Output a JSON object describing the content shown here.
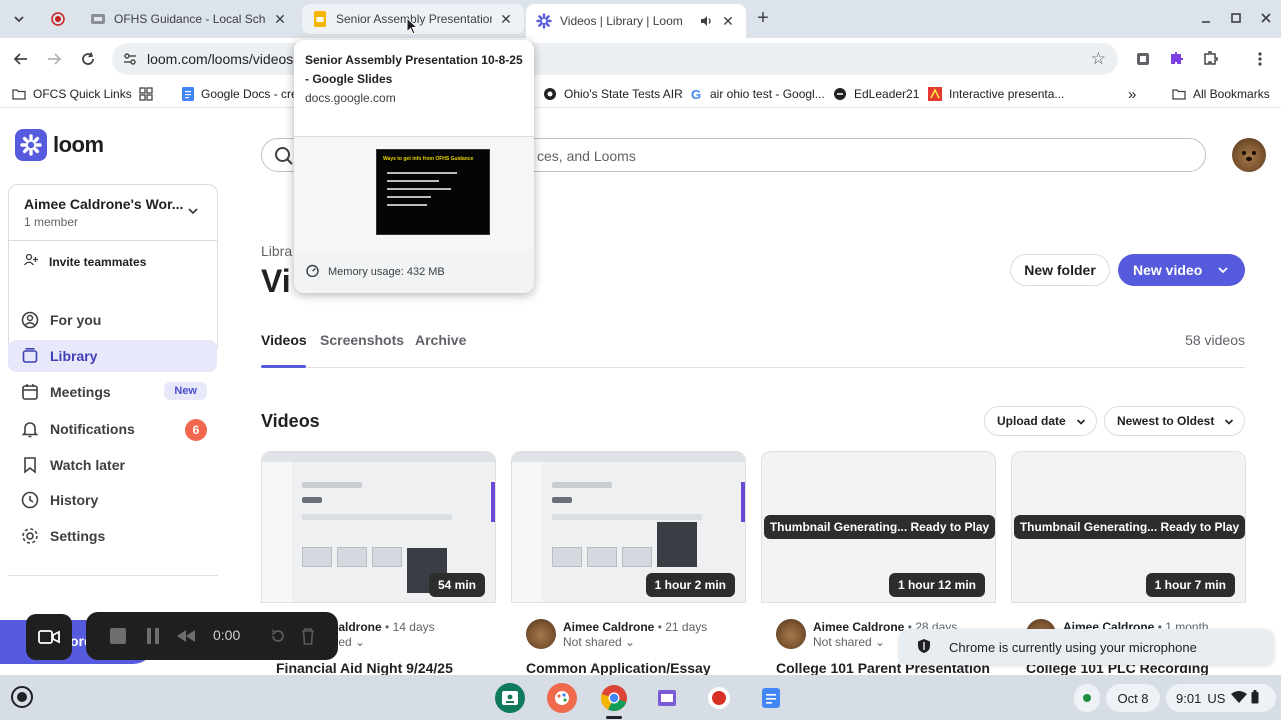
{
  "browser": {
    "tabs": [
      {
        "title": "OFHS Guidance - Local Scholar"
      },
      {
        "title": "Senior Assembly Presentation"
      },
      {
        "title": "Videos | Library | Loom"
      }
    ],
    "url": "loom.com/looms/videos",
    "bookmarks": [
      {
        "label": "OFCS Quick Links"
      },
      {
        "label": "Google Docs - crea"
      },
      {
        "label": "Ohio's State Tests AIR"
      },
      {
        "label": "air ohio test - Googl..."
      },
      {
        "label": "EdLeader21"
      },
      {
        "label": "Interactive presenta..."
      },
      {
        "label": "All Bookmarks"
      }
    ],
    "more_bookmarks_glyph": "»"
  },
  "hover_card": {
    "title": "Senior Assembly Presentation 10-8-25 - Google Slides",
    "domain": "docs.google.com",
    "memory": "Memory usage: 432 MB",
    "slide_heading": "Ways to get info from OFHS Guidance"
  },
  "sidebar": {
    "logo_text": "loom",
    "workspace_name": "Aimee Caldrone's Wor...",
    "workspace_members": "1 member",
    "invite_label": "Invite teammates",
    "nav": [
      {
        "label": "For you"
      },
      {
        "label": "Library"
      },
      {
        "label": "Meetings",
        "badge": "New"
      },
      {
        "label": "Notifications",
        "badge": "6"
      },
      {
        "label": "Watch later"
      },
      {
        "label": "History"
      },
      {
        "label": "Settings"
      }
    ]
  },
  "main": {
    "search_placeholder": "ces, and Looms",
    "breadcrumb": "Libra",
    "page_title": "Vi",
    "new_folder": "New folder",
    "new_video": "New video",
    "tabs": [
      {
        "label": "Videos"
      },
      {
        "label": "Screenshots"
      },
      {
        "label": "Archive"
      }
    ],
    "video_count": "58 videos",
    "section_title": "Videos",
    "sort_field": "Upload date",
    "sort_order": "Newest to Oldest",
    "cards": [
      {
        "author": "ee Caldrone",
        "date": "• 14 days",
        "share": "hared",
        "duration": "54 min",
        "title": "Financial Aid Night 9/24/25",
        "generating": ""
      },
      {
        "author": "Aimee Caldrone",
        "date": "• 21 days",
        "share": "Not shared",
        "duration": "1 hour 2 min",
        "title": "Common Application/Essay",
        "generating": ""
      },
      {
        "author": "Aimee Caldrone",
        "date": "• 28 days",
        "share": "Not shared",
        "duration": "1 hour 12 min",
        "title": "College 101 Parent Presentation",
        "generating": "Thumbnail Generating... Ready to Play"
      },
      {
        "author": "Aimee Caldrone",
        "date": "• 1 month",
        "share": "",
        "duration": "1 hour 7 min",
        "title": "College 101 PLC Recording",
        "generating": "Thumbnail Generating... Ready to Play"
      }
    ]
  },
  "notification": {
    "text": "Chrome is currently using your microphone"
  },
  "recorder": {
    "time": "0:00",
    "button_label": "ord"
  },
  "shelf": {
    "date": "Oct 8",
    "time": "9:01",
    "locale": "US"
  }
}
